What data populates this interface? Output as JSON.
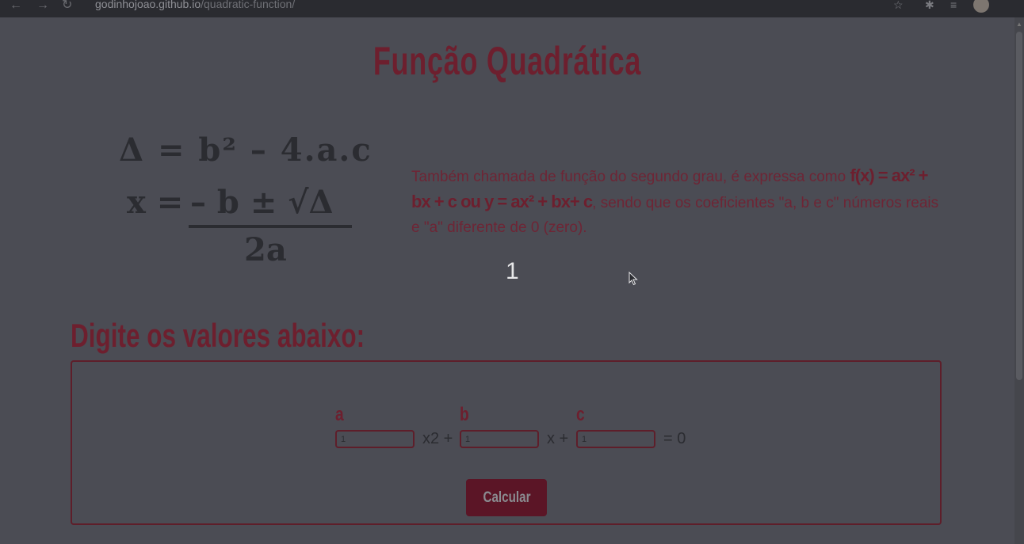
{
  "browser": {
    "url_host": "godinhojoao.github.io",
    "url_path": "/quadratic-function/",
    "back_icon": "←",
    "forward_icon": "→",
    "reload_icon": "↻",
    "star_icon": "☆",
    "extensions_icon": "✱",
    "media_icon": "≡"
  },
  "page": {
    "title": "Função Quadrática",
    "formula_delta": "Δ = b² – 4.a.c",
    "formula_x_left": "x =",
    "formula_x_numerator": "– b ± √Δ",
    "formula_x_denominator": "2a",
    "description_part1": "Também chamada de função do segundo grau, é expressa como ",
    "description_highlight": "f(x) = ax² + bx + c ou y = ax² + bx+ c",
    "description_part2": ", sendo que os coeficientes \"a, b e c\" números reais e \"a\" diferente de 0 (zero).",
    "step_number": "1",
    "subtitle": "Digite os valores abaixo:"
  },
  "form": {
    "label_a": "a",
    "label_b": "b",
    "label_c": "c",
    "value_a": "1",
    "value_b": "1",
    "value_c": "1",
    "op_x2": "x2 +",
    "op_x": "x +",
    "op_eq": "= 0",
    "calculate_label": "Calcular"
  },
  "colors": {
    "background": "#4b4c54",
    "accent": "#6d1f2e",
    "button": "#5b1526"
  }
}
